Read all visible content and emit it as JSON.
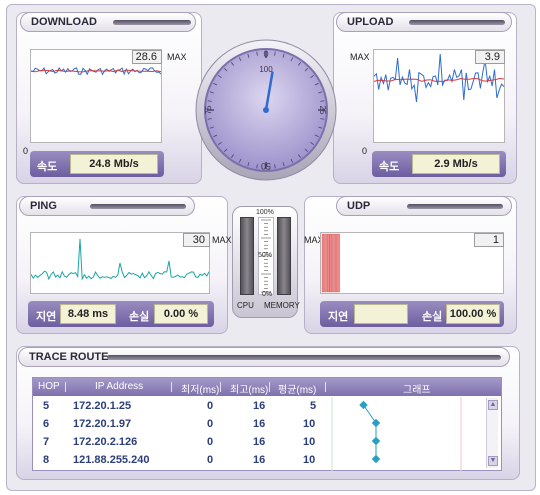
{
  "download": {
    "title": "DOWNLOAD",
    "max_label": "MAX",
    "max_value": "28.6",
    "zero_label": "0",
    "speed_label": "속도",
    "speed_value": "24.8 Mb/s",
    "colors": {
      "primary": "#2f6bd0",
      "secondary": "#d23b3b"
    }
  },
  "upload": {
    "title": "UPLOAD",
    "max_label": "MAX",
    "max_value": "3.9",
    "zero_label": "0",
    "speed_label": "속도",
    "speed_value": "2.9 Mb/s",
    "colors": {
      "primary": "#2f6bd0",
      "secondary": "#d23b3b"
    }
  },
  "gauge": {
    "ticks": [
      "0",
      "25",
      "50",
      "75",
      "100"
    ],
    "value_fraction": 0.33,
    "accent": "#8e80c4"
  },
  "ping": {
    "title": "PING",
    "max_label": "MAX",
    "max_value": "30",
    "latency_label": "지연",
    "latency_value": "8.48 ms",
    "loss_label": "손실",
    "loss_value": "0.00 %",
    "line_color": "#1aa5a5"
  },
  "meters": {
    "scale": [
      "100%",
      "50%",
      "0%"
    ],
    "cpu_label": "CPU",
    "memory_label": "MEMORY"
  },
  "udp": {
    "title": "UDP",
    "max_label": "MAX",
    "max_value": "1",
    "latency_label": "지연",
    "latency_value": "",
    "loss_label": "손실",
    "loss_value": "100.00 %",
    "bar_color": "#f08a8a"
  },
  "traceroute": {
    "title": "TRACE ROUTE",
    "columns": [
      "HOP",
      "IP Address",
      "최저(ms)",
      "최고(ms)",
      "평균(ms)",
      "그래프"
    ],
    "rows": [
      {
        "hop": "5",
        "ip": "172.20.1.25",
        "min": "0",
        "max": "16",
        "avg": "5"
      },
      {
        "hop": "6",
        "ip": "172.20.1.97",
        "min": "0",
        "max": "16",
        "avg": "10"
      },
      {
        "hop": "7",
        "ip": "172.20.2.126",
        "min": "0",
        "max": "16",
        "avg": "10"
      },
      {
        "hop": "8",
        "ip": "121.88.255.240",
        "min": "0",
        "max": "16",
        "avg": "10"
      }
    ],
    "graph_color": "#2a9fc2"
  }
}
